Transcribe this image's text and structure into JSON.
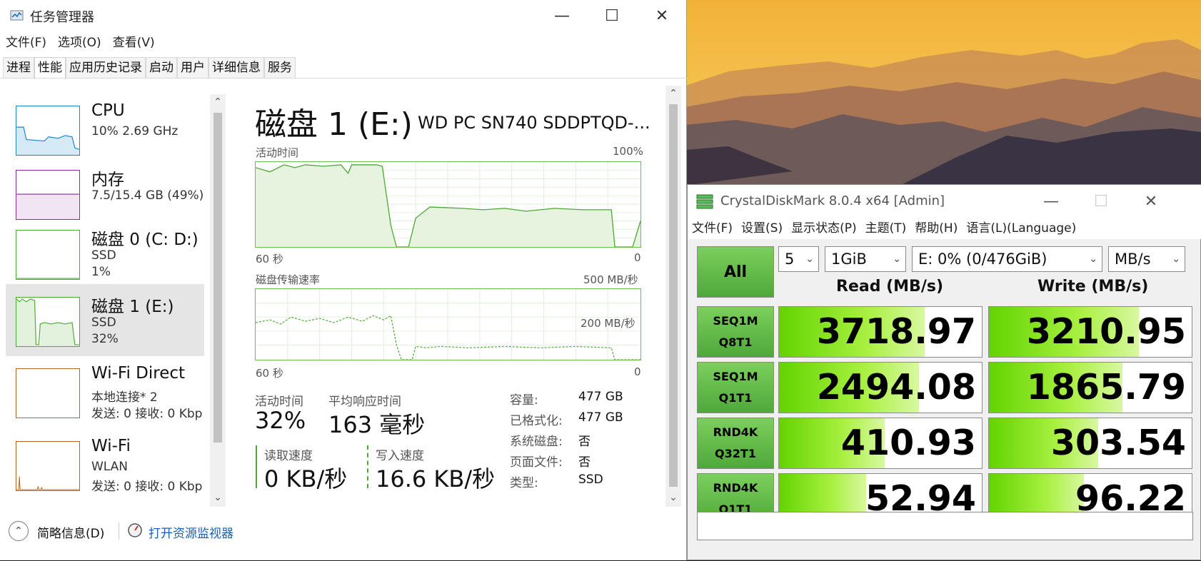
{
  "taskmgr": {
    "title": "任务管理器",
    "menu": [
      "文件(F)",
      "选项(O)",
      "查看(V)"
    ],
    "tabs": [
      "进程",
      "性能",
      "应用历史记录",
      "启动",
      "用户",
      "详细信息",
      "服务"
    ],
    "active_tab": "性能",
    "sidebar": [
      {
        "name": "CPU",
        "line2": "10%  2.69 GHz",
        "line3": "",
        "color": "#1a86c8"
      },
      {
        "name": "内存",
        "line2": "7.5/15.4 GB (49%)",
        "line3": "",
        "color": "#8b2c9e"
      },
      {
        "name": "磁盘 0 (C: D:)",
        "line2": "SSD",
        "line3": "1%",
        "color": "#4da834"
      },
      {
        "name": "磁盘 1 (E:)",
        "line2": "SSD",
        "line3": "32%",
        "color": "#4da834"
      },
      {
        "name": "Wi-Fi Direct",
        "line2": "本地连接* 2",
        "line3": "发送: 0 接收: 0 Kbp",
        "color": "#b5651d"
      },
      {
        "name": "Wi-Fi",
        "line2": "WLAN",
        "line3": "发送: 0 接收: 0 Kbp",
        "color": "#b5651d"
      }
    ],
    "detail": {
      "title": "磁盘 1 (E:)",
      "model": "WD PC SN740 SDDPTQD-...",
      "chart1": {
        "label": "活动时间",
        "max": "100%",
        "left_foot": "60 秒",
        "right_foot": "0"
      },
      "chart2": {
        "label": "磁盘传输速率",
        "max": "500 MB/秒",
        "mid": "200 MB/秒",
        "left_foot": "60 秒",
        "right_foot": "0"
      },
      "active_time_label": "活动时间",
      "active_time_value": "32%",
      "response_label": "平均响应时间",
      "response_value": "163 毫秒",
      "read_label": "读取速度",
      "read_value": "0 KB/秒",
      "write_label": "写入速度",
      "write_value": "16.6 KB/秒",
      "props": [
        {
          "k": "容量:",
          "v": "477 GB"
        },
        {
          "k": "已格式化:",
          "v": "477 GB"
        },
        {
          "k": "系统磁盘:",
          "v": "否"
        },
        {
          "k": "页面文件:",
          "v": "否"
        },
        {
          "k": "类型:",
          "v": "SSD"
        }
      ]
    },
    "footer": {
      "brief": "简略信息(D)",
      "monitor": "打开资源监视器"
    }
  },
  "cdm": {
    "title": "CrystalDiskMark 8.0.4 x64 [Admin]",
    "menu": [
      "文件(F)",
      "设置(S)",
      "显示状态(P)",
      "主题(T)",
      "帮助(H)",
      "语言(L)(Language)"
    ],
    "all_label": "All",
    "count": "5",
    "size": "1GiB",
    "drive": "E: 0% (0/476GiB)",
    "unit": "MB/s",
    "read_head": "Read (MB/s)",
    "write_head": "Write (MB/s)",
    "rows": [
      {
        "l1": "SEQ1M",
        "l2": "Q8T1",
        "read": "3718.97",
        "write": "3210.95",
        "read_frac": 0.72,
        "write_frac": 0.74
      },
      {
        "l1": "SEQ1M",
        "l2": "Q1T1",
        "read": "2494.08",
        "write": "1865.79",
        "read_frac": 0.69,
        "write_frac": 0.66
      },
      {
        "l1": "RND4K",
        "l2": "Q32T1",
        "read": "410.93",
        "write": "303.54",
        "read_frac": 0.52,
        "write_frac": 0.54
      },
      {
        "l1": "RND4K",
        "l2": "Q1T1",
        "read": "52.94",
        "write": "96.22",
        "read_frac": 0.43,
        "write_frac": 0.47
      }
    ]
  }
}
